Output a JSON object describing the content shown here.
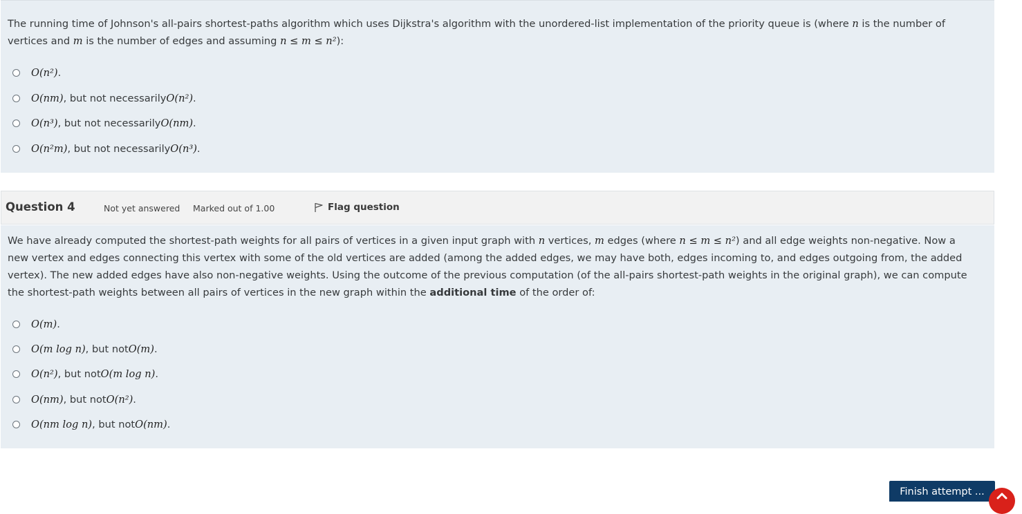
{
  "q3": {
    "stem": {
      "t1": "The running time of Johnson's all-pairs shortest-paths algorithm which uses Dijkstra's algorithm with the unordered-list implementation of the priority queue is (where ",
      "m1": "n",
      "t2": " is the number of vertices and ",
      "m2": "m",
      "t3": " is the number of edges and assuming ",
      "m3": "n ≤ m ≤ n²",
      "t4": "):"
    },
    "answers": [
      {
        "math": "O(n²)",
        "text": ".",
        "math2": "",
        "text2": ""
      },
      {
        "math": "O(nm)",
        "text": ", but not necessarily ",
        "math2": "O(n²)",
        "text2": "."
      },
      {
        "math": "O(n³)",
        "text": ", but not necessarily ",
        "math2": "O(nm)",
        "text2": "."
      },
      {
        "math": "O(n²m)",
        "text": ", but not necessarily ",
        "math2": "O(n³)",
        "text2": "."
      }
    ]
  },
  "q4": {
    "title": "Question 4",
    "state": "Not yet answered",
    "grade": "Marked out of 1.00",
    "flag_label": "Flag question",
    "stem": {
      "t1": "We have already computed the shortest-path weights for all pairs of vertices in a given input graph with ",
      "m1": "n",
      "t2": " vertices, ",
      "m2": "m",
      "t3": " edges (where ",
      "m3": "n ≤ m ≤ n²",
      "t4": ") and all edge weights non-negative. Now a new vertex and edges connecting this vertex with some of the old vertices are added (among the added edges, we may have both, edges incoming to, and edges outgoing from, the added vertex). The new added edges have also non-negative weights. Using the outcome of the previous computation (of the all-pairs shortest-path weights in the original graph), we can compute the shortest-path weights between all pairs of vertices in the new graph within the ",
      "bold": "additional time",
      "t5": " of the order of:"
    },
    "answers": [
      {
        "math": "O(m)",
        "text": ".",
        "math2": "",
        "text2": ""
      },
      {
        "math": "O(m log n)",
        "text": ", but not ",
        "math2": "O(m)",
        "text2": "."
      },
      {
        "math": "O(n²)",
        "text": ", but not ",
        "math2": "O(m log n)",
        "text2": "."
      },
      {
        "math": "O(nm)",
        "text": ", but not ",
        "math2": "O(n²)",
        "text2": "."
      },
      {
        "math": "O(nm log n)",
        "text": ", but not ",
        "math2": "O(nm)",
        "text2": "."
      }
    ]
  },
  "finish_label": "Finish attempt ...",
  "icons": {
    "flag": "flag-icon",
    "scroll_top": "chevron-up-icon"
  },
  "colors": {
    "content_bg": "#e8eef3",
    "info_bg": "#f2f2f2",
    "finish_bg": "#0f3b66",
    "scroll_bg": "#d9211a"
  }
}
